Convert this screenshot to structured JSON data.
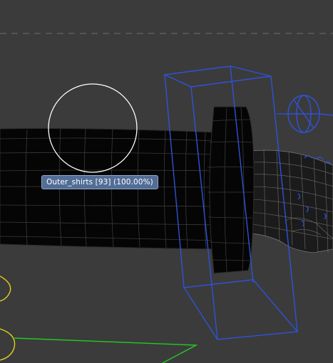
{
  "viewport": {
    "background_color": "#3b3b3b",
    "horizon_line_color": "#6e6e6e",
    "brush_circle_color": "#ffffff",
    "mesh_fill_color": "#050505",
    "wire_color": "#3a3a3a",
    "bone_color": "#2f52d8",
    "curve_yellow": "#e0d020",
    "curve_green": "#22cc22"
  },
  "tooltip": {
    "label": "Outer_shirts [93] (100.00%)"
  }
}
